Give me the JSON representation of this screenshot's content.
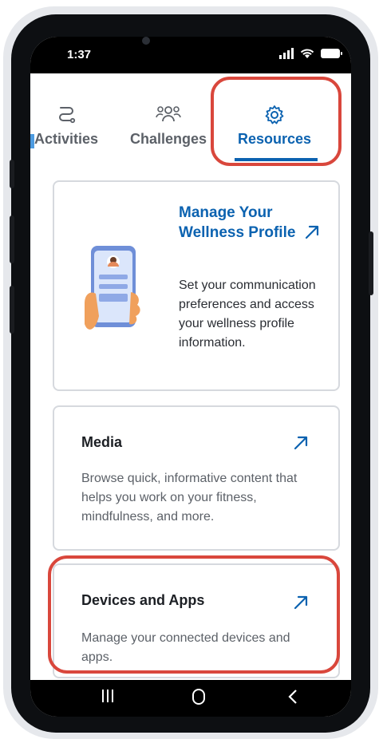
{
  "status_bar": {
    "time": "1:37"
  },
  "tabs": [
    {
      "label": "Activities",
      "icon": "route-icon",
      "selected": false
    },
    {
      "label": "Challenges",
      "icon": "group-icon",
      "selected": false
    },
    {
      "label": "Resources",
      "icon": "gear-icon",
      "selected": true
    }
  ],
  "cards": [
    {
      "title": "Manage Your Wellness Profile",
      "description": "Set your communication preferences and access your wellness profile information.",
      "icon": "external-arrow-icon"
    },
    {
      "title": "Media",
      "description": "Browse quick, informative content that helps you work on your fitness, mindfulness, and more.",
      "icon": "external-arrow-icon"
    },
    {
      "title": "Devices and Apps",
      "description": "Manage your connected devices and apps.",
      "icon": "external-arrow-icon"
    }
  ],
  "navigation_bar": {
    "recent_icon": "recent-apps-icon",
    "home_icon": "home-icon",
    "back_icon": "back-icon"
  },
  "colors": {
    "accent": "#0b62b0",
    "highlight": "#d9473c",
    "text": "#2a2d33",
    "muted": "#5c6168"
  }
}
